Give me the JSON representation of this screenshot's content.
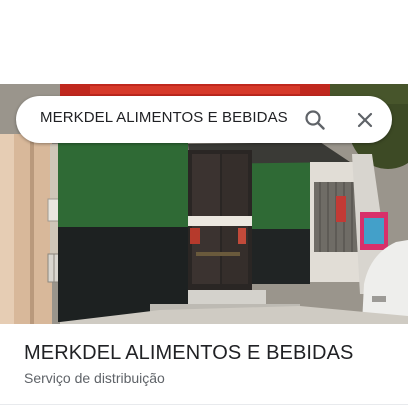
{
  "search": {
    "query": "MERKDEL ALIMENTOS E BEBIDAS",
    "search_icon": "search-icon",
    "close_icon": "close-icon"
  },
  "photo": {
    "kind": "street-view-storefront"
  },
  "place": {
    "name": "MERKDEL ALIMENTOS E BEBIDAS",
    "category": "Serviço de distribuição"
  },
  "colors": {
    "title_text": "#202124",
    "secondary_text": "#5f6368",
    "icon_gray": "#5f6368",
    "storefront_green": "#2f6a35",
    "sign_red": "#c0281e"
  }
}
